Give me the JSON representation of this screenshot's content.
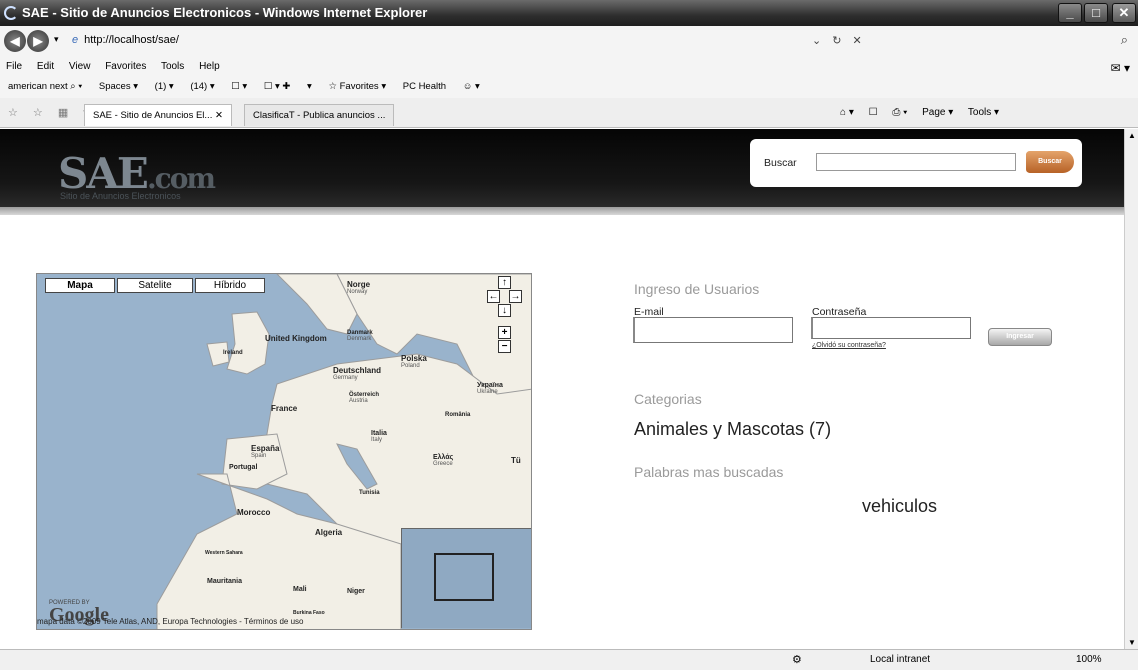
{
  "window": {
    "title": "SAE - Sitio de Anuncios Electronicos - Windows Internet Explorer",
    "minimize": "_",
    "maximize": "□",
    "close": "✕"
  },
  "address": {
    "url": "http://localhost/sae/",
    "right_controls": "⌄ ↻ ✕",
    "search_icon": "⌕"
  },
  "menu": {
    "items": [
      "File",
      "Edit",
      "View",
      "Favorites",
      "Tools",
      "Help"
    ],
    "right_icon": "✉ ▾"
  },
  "links": {
    "items": [
      "american next ⌕ ▾",
      "Spaces ▾",
      "(1) ▾",
      "(14) ▾",
      "☐ ▾",
      "☐ ▾ ✚",
      "▾",
      "☆ Favorites ▾",
      "PC Health",
      "☺ ▾"
    ]
  },
  "tabs": {
    "left_icons": "☆ ☆ ▦ ▾",
    "items": [
      "SAE - Sitio de Anuncios El...",
      "ClasificaT - Publica anuncios ..."
    ],
    "close": "✕",
    "tools": [
      "⌂ ▾",
      "☐",
      "⎙ ▾",
      "Page ▾",
      "Tools ▾"
    ]
  },
  "site": {
    "logo_main": "SAE",
    "logo_com": ".com",
    "logo_tagline": "Sitio de Anuncios Electronicos",
    "search_label": "Buscar",
    "search_value": "",
    "search_button": "Buscar"
  },
  "map": {
    "types": [
      "Mapa",
      "Satelite",
      "Híbrido"
    ],
    "controls": {
      "up": "↑",
      "left": "←",
      "right": "→",
      "down": "↓",
      "zoom_in": "+",
      "zoom_out": "−"
    },
    "labels": [
      {
        "name": "Norge",
        "sub": "Norway"
      },
      {
        "name": "United Kingdom",
        "sub": ""
      },
      {
        "name": "Ireland",
        "sub": ""
      },
      {
        "name": "Danmark",
        "sub": "Denmark"
      },
      {
        "name": "Polska",
        "sub": "Poland"
      },
      {
        "name": "Deutschland",
        "sub": "Germany"
      },
      {
        "name": "Україна",
        "sub": "Ukraine"
      },
      {
        "name": "Österreich",
        "sub": "Austria"
      },
      {
        "name": "France",
        "sub": ""
      },
      {
        "name": "România",
        "sub": ""
      },
      {
        "name": "Italia",
        "sub": "Italy"
      },
      {
        "name": "España",
        "sub": "Spain"
      },
      {
        "name": "Portugal",
        "sub": ""
      },
      {
        "name": "Ελλάς",
        "sub": "Greece"
      },
      {
        "name": "Tunisia",
        "sub": ""
      },
      {
        "name": "Morocco",
        "sub": ""
      },
      {
        "name": "Algeria",
        "sub": ""
      },
      {
        "name": "Western Sahara",
        "sub": ""
      },
      {
        "name": "Mauritania",
        "sub": ""
      },
      {
        "name": "Mali",
        "sub": ""
      },
      {
        "name": "Niger",
        "sub": ""
      },
      {
        "name": "Burkina Faso",
        "sub": ""
      },
      {
        "name": "Tü",
        "sub": ""
      }
    ],
    "powered_by": "POWERED BY",
    "google": "Google",
    "data_credit": "mapa data ©2009 Tele Atlas, AND, Europa Technologies - Términos de uso"
  },
  "login": {
    "title": "Ingreso de Usuarios",
    "email_label": "E-mail",
    "password_label": "Contraseña",
    "button": "Ingresar",
    "forgot": "¿Olvidó su contraseña?"
  },
  "categories": {
    "title": "Categorias",
    "items": [
      "Animales y Mascotas (7)"
    ]
  },
  "keywords": {
    "title": "Palabras mas buscadas",
    "items": [
      "vehiculos"
    ]
  },
  "status": {
    "zone": "Local intranet",
    "zoom": "100%",
    "icon": "⚙"
  }
}
